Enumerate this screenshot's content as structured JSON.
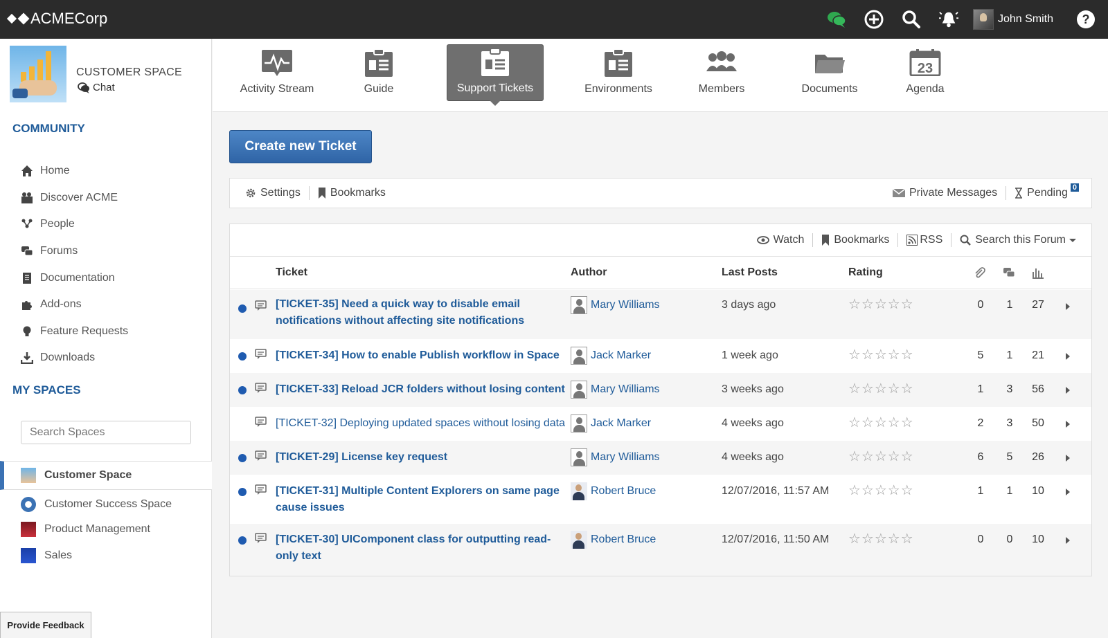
{
  "brand": {
    "name": "ACMECorp"
  },
  "topbar": {
    "user_name": "John Smith"
  },
  "space": {
    "title": "CUSTOMER SPACE",
    "chat_label": "Chat"
  },
  "community": {
    "title": "COMMUNITY",
    "items": [
      {
        "label": "Home",
        "icon": "home-icon"
      },
      {
        "label": "Discover ACME",
        "icon": "discover-icon"
      },
      {
        "label": "People",
        "icon": "people-icon"
      },
      {
        "label": "Forums",
        "icon": "forums-icon"
      },
      {
        "label": "Documentation",
        "icon": "documentation-icon"
      },
      {
        "label": "Add-ons",
        "icon": "puzzle-icon"
      },
      {
        "label": "Feature Requests",
        "icon": "lightbulb-icon"
      },
      {
        "label": "Downloads",
        "icon": "download-icon"
      }
    ]
  },
  "my_spaces": {
    "title": "MY SPACES",
    "search_placeholder": "Search Spaces",
    "items": [
      {
        "label": "Customer Space"
      },
      {
        "label": "Customer Success Space"
      },
      {
        "label": "Product Management"
      },
      {
        "label": "Sales"
      }
    ]
  },
  "feedback_label": "Provide Feedback",
  "tabs": [
    {
      "label": "Activity Stream"
    },
    {
      "label": "Guide"
    },
    {
      "label": "Support Tickets"
    },
    {
      "label": "Environments"
    },
    {
      "label": "Members"
    },
    {
      "label": "Documents"
    },
    {
      "label": "Agenda",
      "day": "23"
    }
  ],
  "create_button": "Create new Ticket",
  "toolbar": {
    "settings": "Settings",
    "bookmarks": "Bookmarks",
    "private_messages": "Private Messages",
    "pending": "Pending",
    "pending_count": "0"
  },
  "forum_tools": {
    "watch": "Watch",
    "bookmarks": "Bookmarks",
    "rss": "RSS",
    "search": "Search this Forum"
  },
  "table": {
    "headers": {
      "ticket": "Ticket",
      "author": "Author",
      "last_posts": "Last Posts",
      "rating": "Rating"
    },
    "rows": [
      {
        "ticket_line1": "[TICKET-35] Need a quick way to disable email",
        "ticket_line2": "notifications without affecting site notifications",
        "author": "Mary Williams",
        "last_post": "3 days ago",
        "rating": "☆☆☆☆☆",
        "attachments": "0",
        "replies": "1",
        "views": "27"
      },
      {
        "ticket_line1": "[TICKET-34] How to enable Publish workflow in Space",
        "ticket_line2": "",
        "author": "Jack Marker",
        "last_post": "1 week ago",
        "rating": "☆☆☆☆☆",
        "attachments": "5",
        "replies": "1",
        "views": "21"
      },
      {
        "ticket_line1": "[TICKET-33] Reload JCR folders without losing content",
        "ticket_line2": "",
        "author": "Mary Williams",
        "last_post": "3 weeks ago",
        "rating": "☆☆☆☆☆",
        "attachments": "1",
        "replies": "3",
        "views": "56"
      },
      {
        "ticket_line1": "[TICKET-32] Deploying updated spaces without losing data",
        "ticket_line2": "",
        "author": "Jack Marker",
        "last_post": "4 weeks ago",
        "rating": "☆☆☆☆☆",
        "attachments": "2",
        "replies": "3",
        "views": "50"
      },
      {
        "ticket_line1": "[TICKET-29] License key request",
        "ticket_line2": "",
        "author": "Mary Williams",
        "last_post": "4 weeks ago",
        "rating": "☆☆☆☆☆",
        "attachments": "6",
        "replies": "5",
        "views": "26"
      },
      {
        "ticket_line1": "[TICKET-31] Multiple Content Explorers on same page",
        "ticket_line2": "cause issues",
        "author": "Robert Bruce",
        "last_post": "12/07/2016, 11:57 AM",
        "rating": "☆☆☆☆☆",
        "attachments": "1",
        "replies": "1",
        "views": "10"
      },
      {
        "ticket_line1": "[TICKET-30] UIComponent class for outputting read-",
        "ticket_line2": "only text",
        "author": "Robert Bruce",
        "last_post": "12/07/2016, 11:50 AM",
        "rating": "☆☆☆☆☆",
        "attachments": "0",
        "replies": "0",
        "views": "10"
      }
    ]
  },
  "colors": {
    "topbar": "#2b2b2b",
    "accent": "#1f5b99",
    "button": "#3a71b3",
    "chat_green": "#2fa84f"
  }
}
